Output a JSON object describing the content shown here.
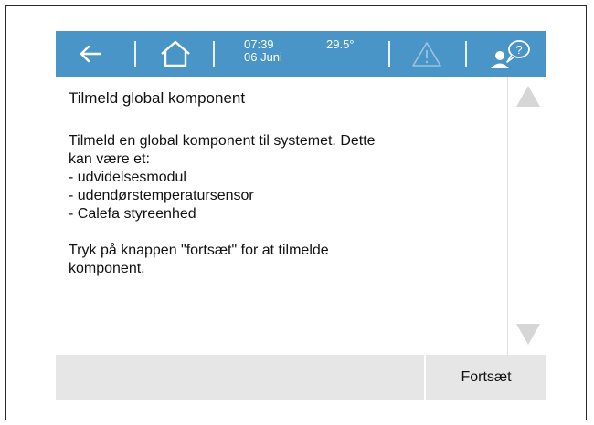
{
  "header": {
    "time": "07:39",
    "date": "06 Juni",
    "temperature": "29.5°",
    "icons": [
      "back-arrow-icon",
      "home-icon",
      "warning-icon",
      "user-help-icon"
    ]
  },
  "page": {
    "title": "Tilmeld global komponent",
    "lines": [
      "Tilmeld en global komponent til systemet. Dette",
      "kan være et:",
      "- udvidelsesmodul",
      "- udendørstemperatursensor",
      "- Calefa styreenhed",
      "",
      "Tryk på knappen \"fortsæt\" for at tilmelde",
      "komponent."
    ]
  },
  "footer": {
    "continue_label": "Fortsæt"
  },
  "colors": {
    "topbar": "#4a95c7",
    "footer": "#e6e6e6",
    "scroll_arrow": "#d6d6d6"
  }
}
